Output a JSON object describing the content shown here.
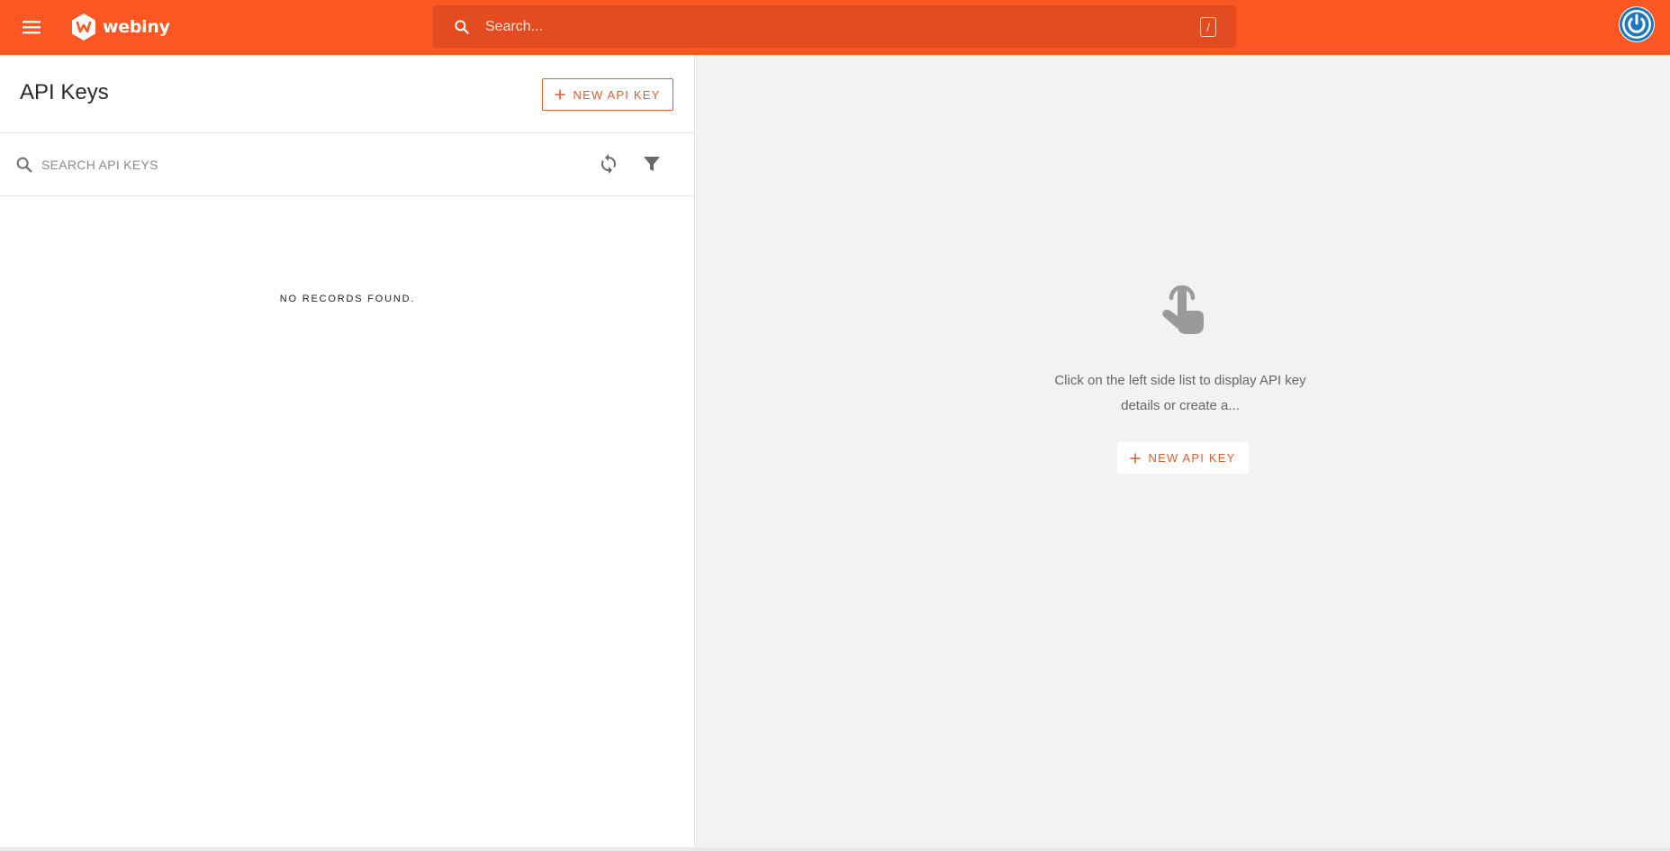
{
  "topbar": {
    "logo_text": "webiny",
    "search_placeholder": "Search...",
    "shortcut_key": "/",
    "bg_color": "#fa5723"
  },
  "list_panel": {
    "title": "API Keys",
    "new_button_label": "NEW API KEY",
    "search_placeholder": "SEARCH API KEYS",
    "empty_text": "NO RECORDS FOUND."
  },
  "detail_panel": {
    "message": "Click on the left side list to display API key details or create a...",
    "new_button_label": "NEW API KEY"
  },
  "icons": {
    "menu": "menu-icon",
    "logo": "webiny-logo-icon",
    "search": "search-icon",
    "avatar": "power-icon",
    "refresh": "refresh-icon",
    "filter": "filter-icon",
    "hand": "touch-hand-icon",
    "plus": "plus-icon"
  },
  "colors": {
    "accent": "#fa5723",
    "button_text": "#d95f32",
    "avatar": "#1d77bf"
  }
}
